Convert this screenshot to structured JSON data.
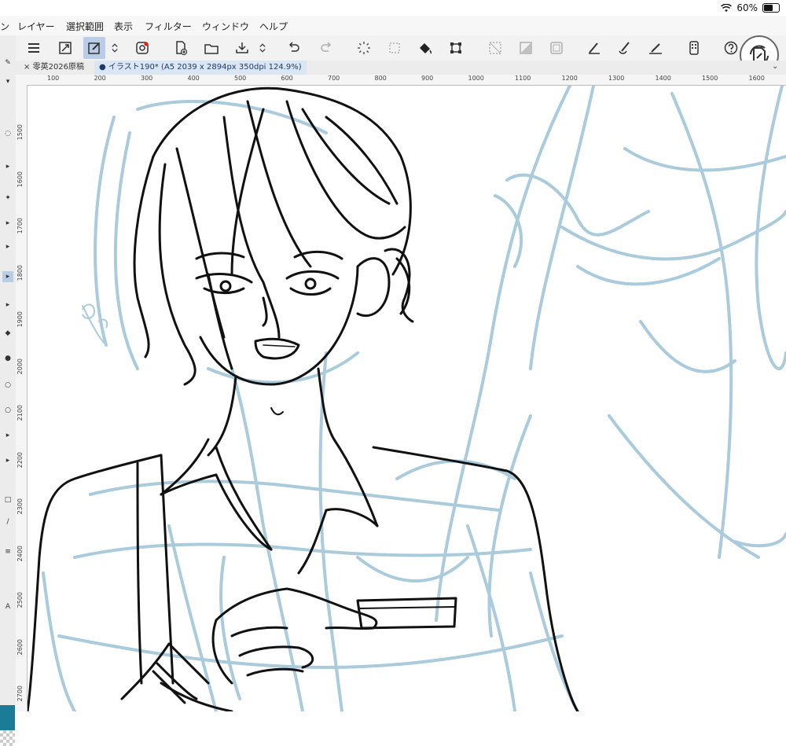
{
  "status": {
    "battery_percent_text": "60%",
    "battery_fraction": 0.6
  },
  "menu": {
    "partial_left": "ン",
    "items": [
      "レイヤー",
      "選択範囲",
      "表示",
      "フィルター",
      "ウィンドウ",
      "ヘルプ"
    ]
  },
  "toolbar": {
    "icons": [
      "menu-icon",
      "fullscreen-icon",
      "edit-pen-icon",
      "updown-arrows-icon",
      "spiral-icon",
      "new-file-icon",
      "open-folder-icon",
      "save-icon",
      "updown-arrows-icon",
      "undo-icon",
      "redo-icon",
      "loading-icon",
      "deselect-icon",
      "fill-icon",
      "transform-icon",
      "grid-icon",
      "tone-icon",
      "frame-icon",
      "stylus-icon",
      "brush-icon",
      "pen-stroke-icon",
      "phone-icon",
      "help-icon"
    ]
  },
  "tabs": [
    {
      "label": "零英2026原稿",
      "close": "×"
    },
    {
      "label": "イラスト190* (A5 2039 x 2894px 350dpi 124.9%)",
      "dot": "●"
    }
  ],
  "ruler": {
    "top": [
      "100",
      "200",
      "300",
      "400",
      "500",
      "600",
      "700",
      "800",
      "900",
      "1000",
      "1100",
      "1200",
      "1300",
      "1400",
      "1500",
      "1600"
    ],
    "left": [
      "1500",
      "1600",
      "1700",
      "1800",
      "1900",
      "2000",
      "2100",
      "2200",
      "2300",
      "2400",
      "2500",
      "2600",
      "2700"
    ]
  },
  "colors": {
    "accent": "#b9cde6",
    "sketch": "#a9cbdc",
    "ink": "#111111",
    "swatch": "#1b7c98"
  },
  "canvas": {
    "content": "line-art-illustration"
  }
}
